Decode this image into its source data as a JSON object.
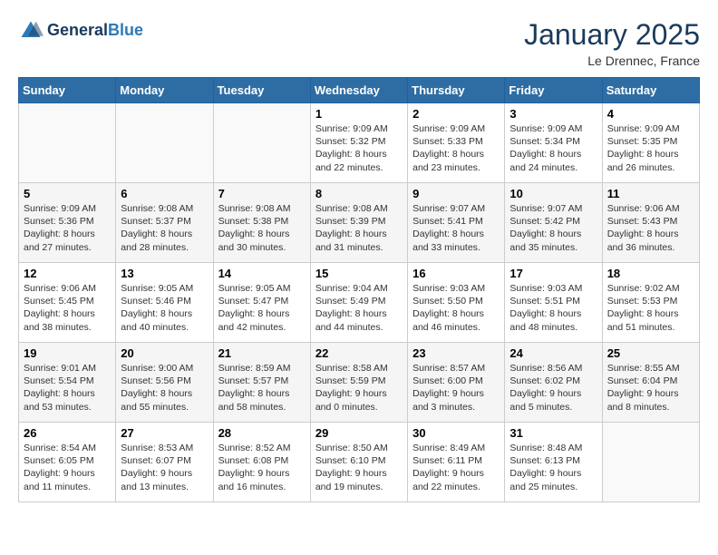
{
  "header": {
    "logo_general": "General",
    "logo_blue": "Blue",
    "month": "January 2025",
    "location": "Le Drennec, France"
  },
  "weekdays": [
    "Sunday",
    "Monday",
    "Tuesday",
    "Wednesday",
    "Thursday",
    "Friday",
    "Saturday"
  ],
  "weeks": [
    [
      {
        "day": "",
        "info": ""
      },
      {
        "day": "",
        "info": ""
      },
      {
        "day": "",
        "info": ""
      },
      {
        "day": "1",
        "info": "Sunrise: 9:09 AM\nSunset: 5:32 PM\nDaylight: 8 hours\nand 22 minutes."
      },
      {
        "day": "2",
        "info": "Sunrise: 9:09 AM\nSunset: 5:33 PM\nDaylight: 8 hours\nand 23 minutes."
      },
      {
        "day": "3",
        "info": "Sunrise: 9:09 AM\nSunset: 5:34 PM\nDaylight: 8 hours\nand 24 minutes."
      },
      {
        "day": "4",
        "info": "Sunrise: 9:09 AM\nSunset: 5:35 PM\nDaylight: 8 hours\nand 26 minutes."
      }
    ],
    [
      {
        "day": "5",
        "info": "Sunrise: 9:09 AM\nSunset: 5:36 PM\nDaylight: 8 hours\nand 27 minutes."
      },
      {
        "day": "6",
        "info": "Sunrise: 9:08 AM\nSunset: 5:37 PM\nDaylight: 8 hours\nand 28 minutes."
      },
      {
        "day": "7",
        "info": "Sunrise: 9:08 AM\nSunset: 5:38 PM\nDaylight: 8 hours\nand 30 minutes."
      },
      {
        "day": "8",
        "info": "Sunrise: 9:08 AM\nSunset: 5:39 PM\nDaylight: 8 hours\nand 31 minutes."
      },
      {
        "day": "9",
        "info": "Sunrise: 9:07 AM\nSunset: 5:41 PM\nDaylight: 8 hours\nand 33 minutes."
      },
      {
        "day": "10",
        "info": "Sunrise: 9:07 AM\nSunset: 5:42 PM\nDaylight: 8 hours\nand 35 minutes."
      },
      {
        "day": "11",
        "info": "Sunrise: 9:06 AM\nSunset: 5:43 PM\nDaylight: 8 hours\nand 36 minutes."
      }
    ],
    [
      {
        "day": "12",
        "info": "Sunrise: 9:06 AM\nSunset: 5:45 PM\nDaylight: 8 hours\nand 38 minutes."
      },
      {
        "day": "13",
        "info": "Sunrise: 9:05 AM\nSunset: 5:46 PM\nDaylight: 8 hours\nand 40 minutes."
      },
      {
        "day": "14",
        "info": "Sunrise: 9:05 AM\nSunset: 5:47 PM\nDaylight: 8 hours\nand 42 minutes."
      },
      {
        "day": "15",
        "info": "Sunrise: 9:04 AM\nSunset: 5:49 PM\nDaylight: 8 hours\nand 44 minutes."
      },
      {
        "day": "16",
        "info": "Sunrise: 9:03 AM\nSunset: 5:50 PM\nDaylight: 8 hours\nand 46 minutes."
      },
      {
        "day": "17",
        "info": "Sunrise: 9:03 AM\nSunset: 5:51 PM\nDaylight: 8 hours\nand 48 minutes."
      },
      {
        "day": "18",
        "info": "Sunrise: 9:02 AM\nSunset: 5:53 PM\nDaylight: 8 hours\nand 51 minutes."
      }
    ],
    [
      {
        "day": "19",
        "info": "Sunrise: 9:01 AM\nSunset: 5:54 PM\nDaylight: 8 hours\nand 53 minutes."
      },
      {
        "day": "20",
        "info": "Sunrise: 9:00 AM\nSunset: 5:56 PM\nDaylight: 8 hours\nand 55 minutes."
      },
      {
        "day": "21",
        "info": "Sunrise: 8:59 AM\nSunset: 5:57 PM\nDaylight: 8 hours\nand 58 minutes."
      },
      {
        "day": "22",
        "info": "Sunrise: 8:58 AM\nSunset: 5:59 PM\nDaylight: 9 hours\nand 0 minutes."
      },
      {
        "day": "23",
        "info": "Sunrise: 8:57 AM\nSunset: 6:00 PM\nDaylight: 9 hours\nand 3 minutes."
      },
      {
        "day": "24",
        "info": "Sunrise: 8:56 AM\nSunset: 6:02 PM\nDaylight: 9 hours\nand 5 minutes."
      },
      {
        "day": "25",
        "info": "Sunrise: 8:55 AM\nSunset: 6:04 PM\nDaylight: 9 hours\nand 8 minutes."
      }
    ],
    [
      {
        "day": "26",
        "info": "Sunrise: 8:54 AM\nSunset: 6:05 PM\nDaylight: 9 hours\nand 11 minutes."
      },
      {
        "day": "27",
        "info": "Sunrise: 8:53 AM\nSunset: 6:07 PM\nDaylight: 9 hours\nand 13 minutes."
      },
      {
        "day": "28",
        "info": "Sunrise: 8:52 AM\nSunset: 6:08 PM\nDaylight: 9 hours\nand 16 minutes."
      },
      {
        "day": "29",
        "info": "Sunrise: 8:50 AM\nSunset: 6:10 PM\nDaylight: 9 hours\nand 19 minutes."
      },
      {
        "day": "30",
        "info": "Sunrise: 8:49 AM\nSunset: 6:11 PM\nDaylight: 9 hours\nand 22 minutes."
      },
      {
        "day": "31",
        "info": "Sunrise: 8:48 AM\nSunset: 6:13 PM\nDaylight: 9 hours\nand 25 minutes."
      },
      {
        "day": "",
        "info": ""
      }
    ]
  ]
}
